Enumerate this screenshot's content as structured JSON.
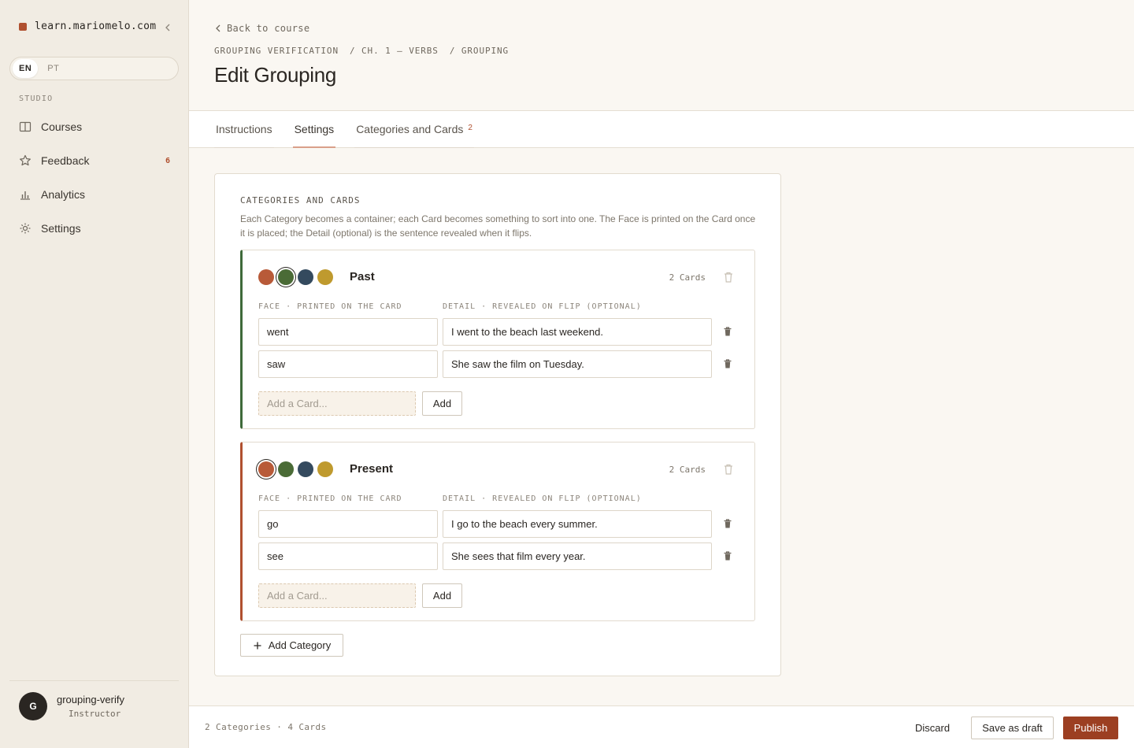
{
  "sidebar": {
    "brand": "learn.mariomelo.com",
    "languages": [
      "EN",
      "PT"
    ],
    "section": "STUDIO",
    "items": [
      {
        "label": "Courses",
        "badge": ""
      },
      {
        "label": "Feedback",
        "badge": "6"
      },
      {
        "label": "Analytics",
        "badge": ""
      },
      {
        "label": "Settings",
        "badge": ""
      }
    ],
    "user": {
      "initial": "G",
      "name": "grouping-verify",
      "role": "Instructor"
    }
  },
  "header": {
    "back": "Back to course",
    "breadcrumbs": [
      "GROUPING VERIFICATION",
      "/ CH. 1 — VERBS",
      "/ GROUPING"
    ],
    "title": "Edit Grouping"
  },
  "tabs": [
    {
      "label": "Instructions",
      "count": ""
    },
    {
      "label": "Settings",
      "count": ""
    },
    {
      "label": "Categories and Cards",
      "count": "2"
    }
  ],
  "panel": {
    "heading": "CATEGORIES AND CARDS",
    "description": "Each Category becomes a container; each Card becomes something to sort into one. The Face is printed on the Card once it is placed; the Detail (optional) is the sentence revealed when it flips.",
    "face_col": "FACE · PRINTED ON THE CARD",
    "detail_col": "DETAIL · REVEALED ON FLIP (OPTIONAL)",
    "add_placeholder": "Add a Card...",
    "add_label": "Add",
    "add_category": "Add Category",
    "swatch_colors": [
      "#b85a38",
      "#4a6b36",
      "#344a5e",
      "#bf9a2e"
    ],
    "categories": [
      {
        "name": "Past",
        "count": "2 Cards",
        "color": "#3f6a3a",
        "cards": [
          {
            "face": "went",
            "detail": "I went to the beach last weekend."
          },
          {
            "face": "saw",
            "detail": "She saw the film on Tuesday."
          }
        ]
      },
      {
        "name": "Present",
        "count": "2 Cards",
        "color": "#b0502f",
        "cards": [
          {
            "face": "go",
            "detail": "I go to the beach every summer."
          },
          {
            "face": "see",
            "detail": "She sees that film every year."
          }
        ]
      }
    ]
  },
  "footer": {
    "stats": "2 Categories · 4 Cards",
    "discard": "Discard",
    "draft": "Save as draft",
    "publish": "Publish"
  }
}
